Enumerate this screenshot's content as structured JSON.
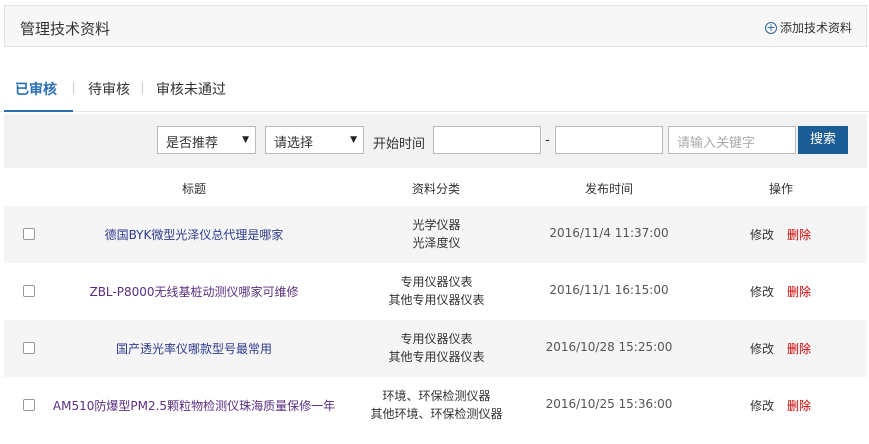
{
  "header": {
    "title": "管理技术资料",
    "add_label": "添加技术资料"
  },
  "tabs": [
    {
      "label": "已审核",
      "active": true
    },
    {
      "label": "待审核",
      "active": false
    },
    {
      "label": "审核未通过",
      "active": false
    }
  ],
  "filter": {
    "recommend_select": "是否推荐",
    "category_select": "请选择",
    "start_time_label": "开始时间",
    "start_value": "",
    "end_value": "",
    "range_sep": "-",
    "keyword_placeholder": "请输入关键字",
    "search_label": "搜索"
  },
  "table": {
    "columns": [
      "标题",
      "资料分类",
      "发布时间",
      "操作"
    ],
    "rows": [
      {
        "title": "德国BYK微型光泽仪总代理是哪家",
        "cat1": "光学仪器",
        "cat2": "光泽度仪",
        "date": "2016/11/4 11:37:00",
        "edit": "修改",
        "del": "删除"
      },
      {
        "title": "ZBL-P8000无线基桩动测仪哪家可维修",
        "cat1": "专用仪器仪表",
        "cat2": "其他专用仪器仪表",
        "date": "2016/11/1 16:15:00",
        "edit": "修改",
        "del": "删除"
      },
      {
        "title": "国产透光率仪哪款型号最常用",
        "cat1": "专用仪器仪表",
        "cat2": "其他专用仪器仪表",
        "date": "2016/10/28 15:25:00",
        "edit": "修改",
        "del": "删除"
      },
      {
        "title": "AM510防爆型PM2.5颗粒物检测仪珠海质量保修一年",
        "cat1": "环境、环保检测仪器",
        "cat2": "其他环境、环保检测仪器",
        "date": "2016/10/25 15:36:00",
        "edit": "修改",
        "del": "删除"
      }
    ]
  },
  "colors": {
    "accent": "#2a6fb6",
    "search_button": "#1d5d95",
    "delete": "#cc0000"
  }
}
